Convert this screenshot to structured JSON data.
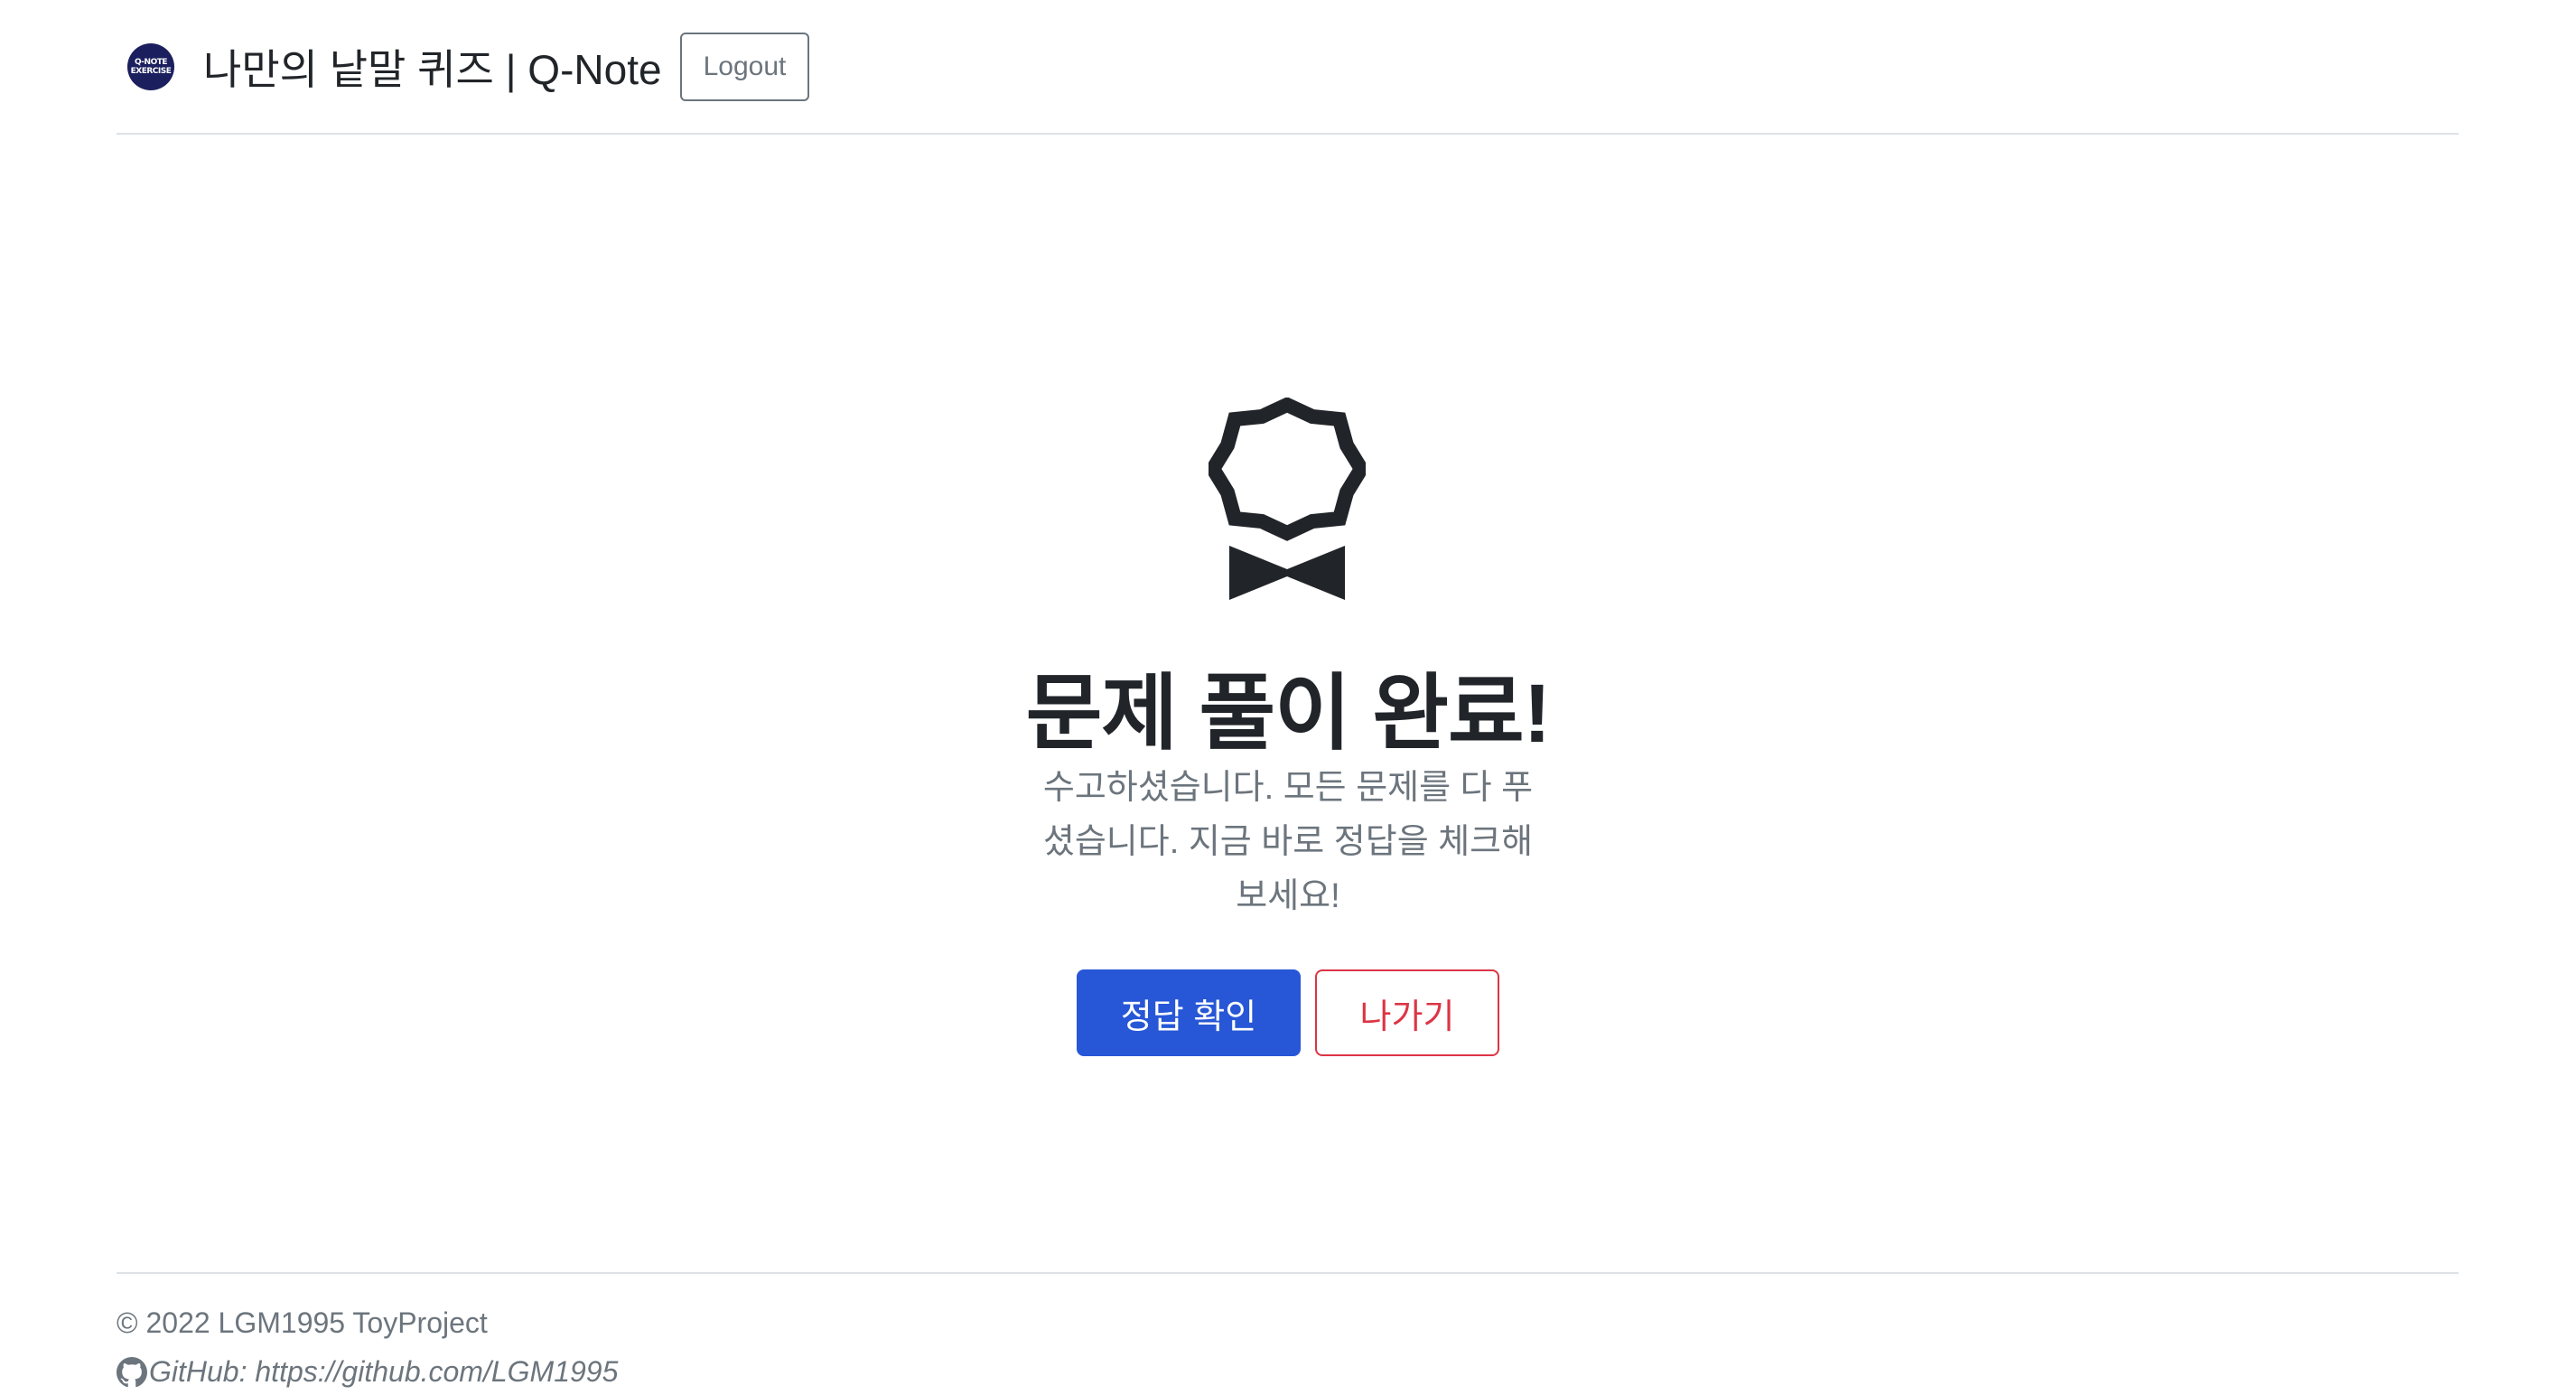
{
  "header": {
    "logo_text_top": "Q-NOTE",
    "logo_text_bottom": "EXERCISE",
    "title": "나만의 낱말 퀴즈 | Q-Note",
    "logout_label": "Logout"
  },
  "main": {
    "icon": "award-icon",
    "title": "문제 풀이 완료!",
    "message": "수고하셨습니다. 모든 문제를 다 푸셨습니다. 지금 바로 정답을 체크해보세요!",
    "check_answer_label": "정답 확인",
    "exit_label": "나가기"
  },
  "footer": {
    "copyright": "© 2022 LGM1995 ToyProject",
    "github_icon": "github-icon",
    "github_text": "GitHub: https://github.com/LGM1995"
  },
  "colors": {
    "primary": "#2757d6",
    "danger": "#dc3545",
    "secondary": "#6c757d",
    "logo_bg": "#1b1f5e"
  }
}
